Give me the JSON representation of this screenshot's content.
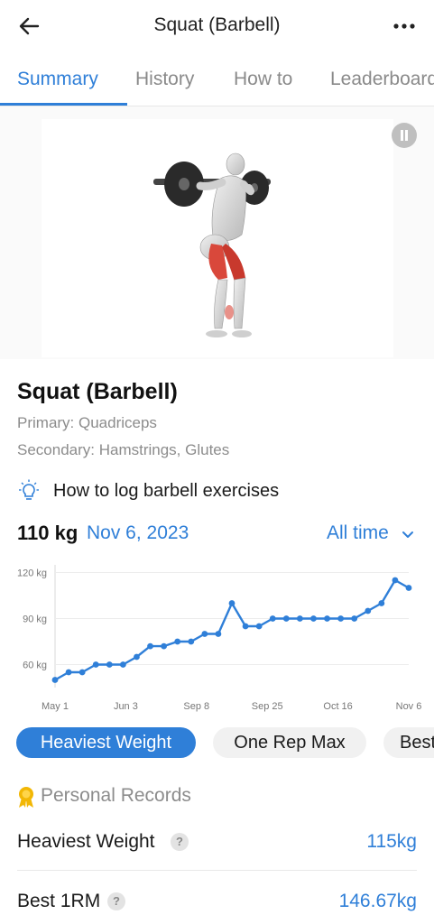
{
  "header": {
    "title": "Squat (Barbell)",
    "back_icon": "arrow-left-icon",
    "more_icon": "more-horizontal-icon"
  },
  "tabs": [
    {
      "label": "Summary",
      "active": true
    },
    {
      "label": "History",
      "active": false
    },
    {
      "label": "How to",
      "active": false
    },
    {
      "label": "Leaderboard",
      "active": false
    }
  ],
  "media": {
    "pause_icon": "pause-icon"
  },
  "exercise": {
    "name": "Squat (Barbell)",
    "primary": "Primary: Quadriceps",
    "secondary": "Secondary: Hamstrings, Glutes",
    "howto_link": "How to log barbell exercises",
    "howto_icon": "lightbulb-icon"
  },
  "stat": {
    "value": "110 kg",
    "date": "Nov 6, 2023",
    "range": "All time"
  },
  "chart_data": {
    "type": "line",
    "x_labels": [
      "May 1",
      "Jun 3",
      "Sep 8",
      "Sep 25",
      "Oct 16",
      "Nov 6"
    ],
    "y_ticks": [
      "120 kg",
      "90 kg",
      "60 kg"
    ],
    "y_values": [
      120,
      90,
      60
    ],
    "ylim": [
      45,
      125
    ],
    "grid": true,
    "values": [
      50,
      55,
      55,
      60,
      60,
      60,
      65,
      72,
      72,
      75,
      75,
      80,
      80,
      100,
      85,
      85,
      90,
      90,
      90,
      90,
      90,
      90,
      90,
      95,
      100,
      115,
      110
    ],
    "color": "#2f7fd8"
  },
  "pills": [
    {
      "label": "Heaviest Weight",
      "active": true
    },
    {
      "label": "One Rep Max",
      "active": false
    },
    {
      "label": "Best Set Volume",
      "active": false
    }
  ],
  "records": {
    "title": "Personal Records",
    "icon": "medal-icon",
    "items": [
      {
        "label": "Heaviest Weight",
        "value": "115kg"
      },
      {
        "label": "Best 1RM",
        "value": "146.67kg"
      }
    ]
  },
  "colors": {
    "accent": "#2f7fd8",
    "muscle_highlight": "#d9483b",
    "medal": "#f2b705"
  }
}
